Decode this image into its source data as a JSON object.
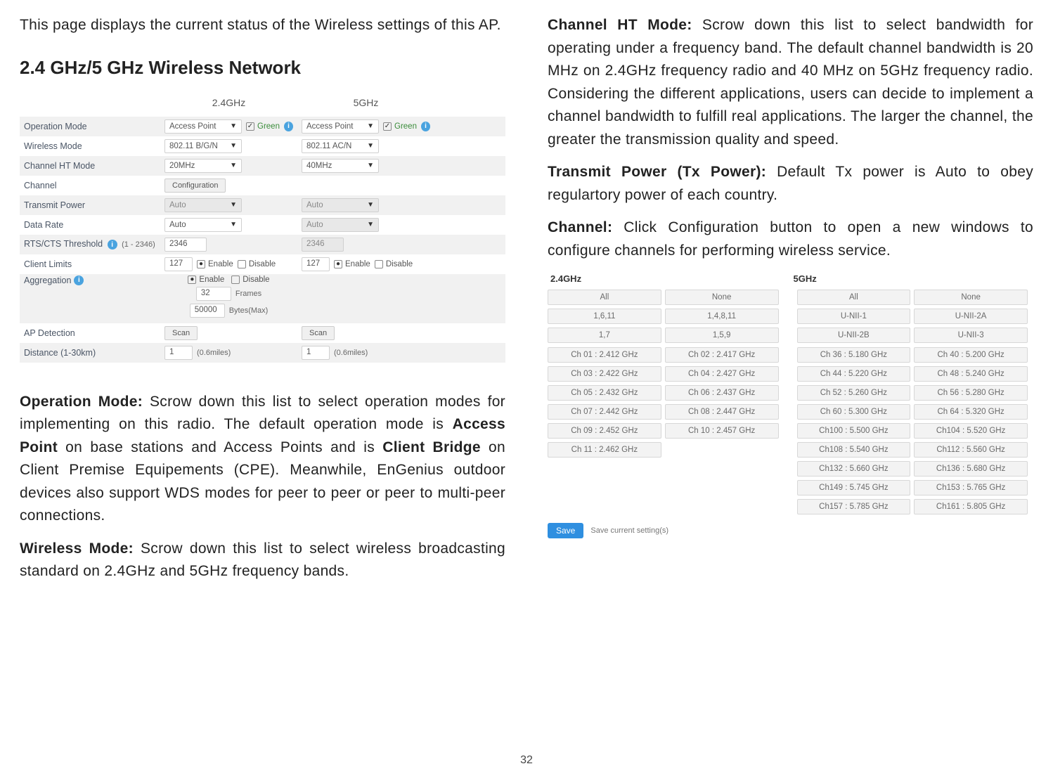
{
  "page_number": "32",
  "left": {
    "intro": "This page displays the current status of the Wireless settings of this AP.",
    "heading": "2.4 GHz/5 GHz Wireless Network",
    "settings": {
      "col24_header": "2.4GHz",
      "col5_header": "5GHz",
      "rows": {
        "operation_mode": {
          "label": "Operation Mode",
          "v24": "Access Point",
          "v5": "Access Point",
          "green": "Green"
        },
        "wireless_mode": {
          "label": "Wireless Mode",
          "v24": "802.11 B/G/N",
          "v5": "802.11 AC/N"
        },
        "channel_ht": {
          "label": "Channel HT Mode",
          "v24": "20MHz",
          "v5": "40MHz"
        },
        "channel": {
          "label": "Channel",
          "btn": "Configuration"
        },
        "tx_power": {
          "label": "Transmit Power",
          "v24": "Auto",
          "v5": "Auto"
        },
        "data_rate": {
          "label": "Data Rate",
          "v24": "Auto",
          "v5": "Auto"
        },
        "rtscts": {
          "label": "RTS/CTS Threshold",
          "range": "(1 - 2346)",
          "v24": "2346",
          "v5": "2346"
        },
        "client_limits": {
          "label": "Client Limits",
          "v24": "127",
          "v5": "127",
          "enable": "Enable",
          "disable": "Disable"
        },
        "aggregation": {
          "label": "Aggregation",
          "enable": "Enable",
          "disable": "Disable",
          "frames_val": "32",
          "frames_lbl": "Frames",
          "bytes_val": "50000",
          "bytes_lbl": "Bytes(Max)"
        },
        "ap_detection": {
          "label": "AP Detection",
          "btn": "Scan"
        },
        "distance": {
          "label": "Distance (1-30km)",
          "v": "1",
          "miles": "(0.6miles)"
        }
      }
    },
    "p_opmode_lead": "Operation Mode:",
    "p_opmode_body": " Scrow down this list to select operation modes for implementing on this radio. The default operation mode is ",
    "p_opmode_bold1": "Access Point",
    "p_opmode_mid": " on base stations and Access Points and is ",
    "p_opmode_bold2": "Client Bridge",
    "p_opmode_tail": " on Client Premise Equipements (CPE). Meanwhile, EnGenius outdoor devices also support WDS modes for peer to peer or peer to multi-peer connections.",
    "p_wmode_lead": "Wireless Mode:",
    "p_wmode_body": " Scrow down this list to select wireless broadcasting standard on 2.4GHz and 5GHz frequency bands."
  },
  "right": {
    "p_ht_lead": "Channel HT Mode:",
    "p_ht_body": " Scrow down this list to select bandwidth for operating under a frequency band. The default channel bandwidth is 20 MHz on 2.4GHz frequency radio and 40 MHz on 5GHz frequency radio. Considering the different applications, users can decide to implement a channel bandwidth to fulfill real applications. The larger the channel, the greater the transmission quality and speed.",
    "p_tx_lead": "Transmit Power (Tx Power):",
    "p_tx_body": " Default Tx power is Auto to obey regulartory power of each country.",
    "p_ch_lead": "Channel:",
    "p_ch_body": " Click Configuration button to open a new windows to configure channels for performing wireless service.",
    "channels": {
      "h24": "2.4GHz",
      "h5": "5GHz",
      "groups24_top": [
        "All",
        "None",
        "1,6,11",
        "1,4,8,11",
        "1,7",
        "1,5,9"
      ],
      "list24": [
        "Ch 01 : 2.412 GHz",
        "Ch 02 : 2.417 GHz",
        "Ch 03 : 2.422 GHz",
        "Ch 04 : 2.427 GHz",
        "Ch 05 : 2.432 GHz",
        "Ch 06 : 2.437 GHz",
        "Ch 07 : 2.442 GHz",
        "Ch 08 : 2.447 GHz",
        "Ch 09 : 2.452 GHz",
        "Ch 10 : 2.457 GHz",
        "Ch 11 : 2.462 GHz"
      ],
      "groups5_top": [
        "All",
        "None",
        "U-NII-1",
        "U-NII-2A",
        "U-NII-2B",
        "U-NII-3"
      ],
      "list5": [
        "Ch 36 : 5.180 GHz",
        "Ch 40 : 5.200 GHz",
        "Ch 44 : 5.220 GHz",
        "Ch 48 : 5.240 GHz",
        "Ch 52 : 5.260 GHz",
        "Ch 56 : 5.280 GHz",
        "Ch 60 : 5.300 GHz",
        "Ch 64 : 5.320 GHz",
        "Ch100 : 5.500 GHz",
        "Ch104 : 5.520 GHz",
        "Ch108 : 5.540 GHz",
        "Ch112 : 5.560 GHz",
        "Ch132 : 5.660 GHz",
        "Ch136 : 5.680 GHz",
        "Ch149 : 5.745 GHz",
        "Ch153 : 5.765 GHz",
        "Ch157 : 5.785 GHz",
        "Ch161 : 5.805 GHz"
      ],
      "save": "Save",
      "save_msg": "Save current setting(s)"
    }
  }
}
